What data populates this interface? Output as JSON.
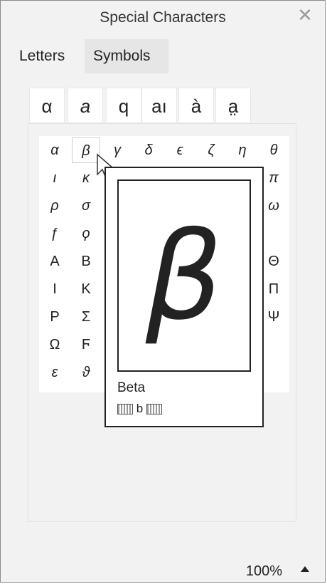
{
  "window": {
    "title": "Special Characters",
    "close_glyph": "✕"
  },
  "tabs": [
    {
      "label": "Letters",
      "active": true
    },
    {
      "label": "Symbols",
      "active": false
    }
  ],
  "style_variants": [
    "α",
    "a",
    "q",
    "aı",
    "à",
    "a̤"
  ],
  "grid": {
    "rows": [
      [
        "α",
        "β",
        "γ",
        "δ",
        "ϵ",
        "ζ",
        "η",
        "θ"
      ],
      [
        "ι",
        "κ",
        "",
        "",
        "",
        "",
        "",
        "π"
      ],
      [
        "ρ",
        "σ",
        "",
        "",
        "",
        "",
        "",
        "ω"
      ],
      [
        "ƒ",
        "ϙ",
        "",
        "",
        "",
        "",
        "",
        ""
      ],
      [
        "A",
        "B",
        "",
        "",
        "",
        "",
        "",
        "Θ"
      ],
      [
        "I",
        "K",
        "",
        "",
        "",
        "",
        "",
        "Π"
      ],
      [
        "P",
        "Σ",
        "",
        "",
        "",
        "",
        "",
        "Ψ"
      ],
      [
        "Ω",
        "Ϝ",
        "",
        "",
        "",
        "",
        "",
        ""
      ],
      [
        "ε",
        "ϑ",
        "",
        "",
        "",
        "",
        "",
        ""
      ]
    ],
    "selected": "β"
  },
  "preview": {
    "glyph": "β",
    "name": "Beta",
    "shortcut_key": "b"
  },
  "status": {
    "zoom": "100%",
    "zoom_icon": "triangle-up-icon"
  }
}
